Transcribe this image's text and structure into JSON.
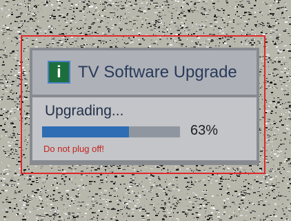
{
  "dialog": {
    "icon": {
      "name": "info-icon",
      "glyph": "i",
      "background": "#1d6e3d",
      "border": "#4a7fc4"
    },
    "title": "TV Software Upgrade",
    "status_text": "Upgrading...",
    "progress": {
      "fraction": 0.63,
      "label": "63%"
    },
    "warning": "Do not plug off!"
  },
  "colors": {
    "highlight_frame": "#e0282a",
    "progress_fill": "#2e6cb4",
    "warning_text": "#c4221f"
  }
}
